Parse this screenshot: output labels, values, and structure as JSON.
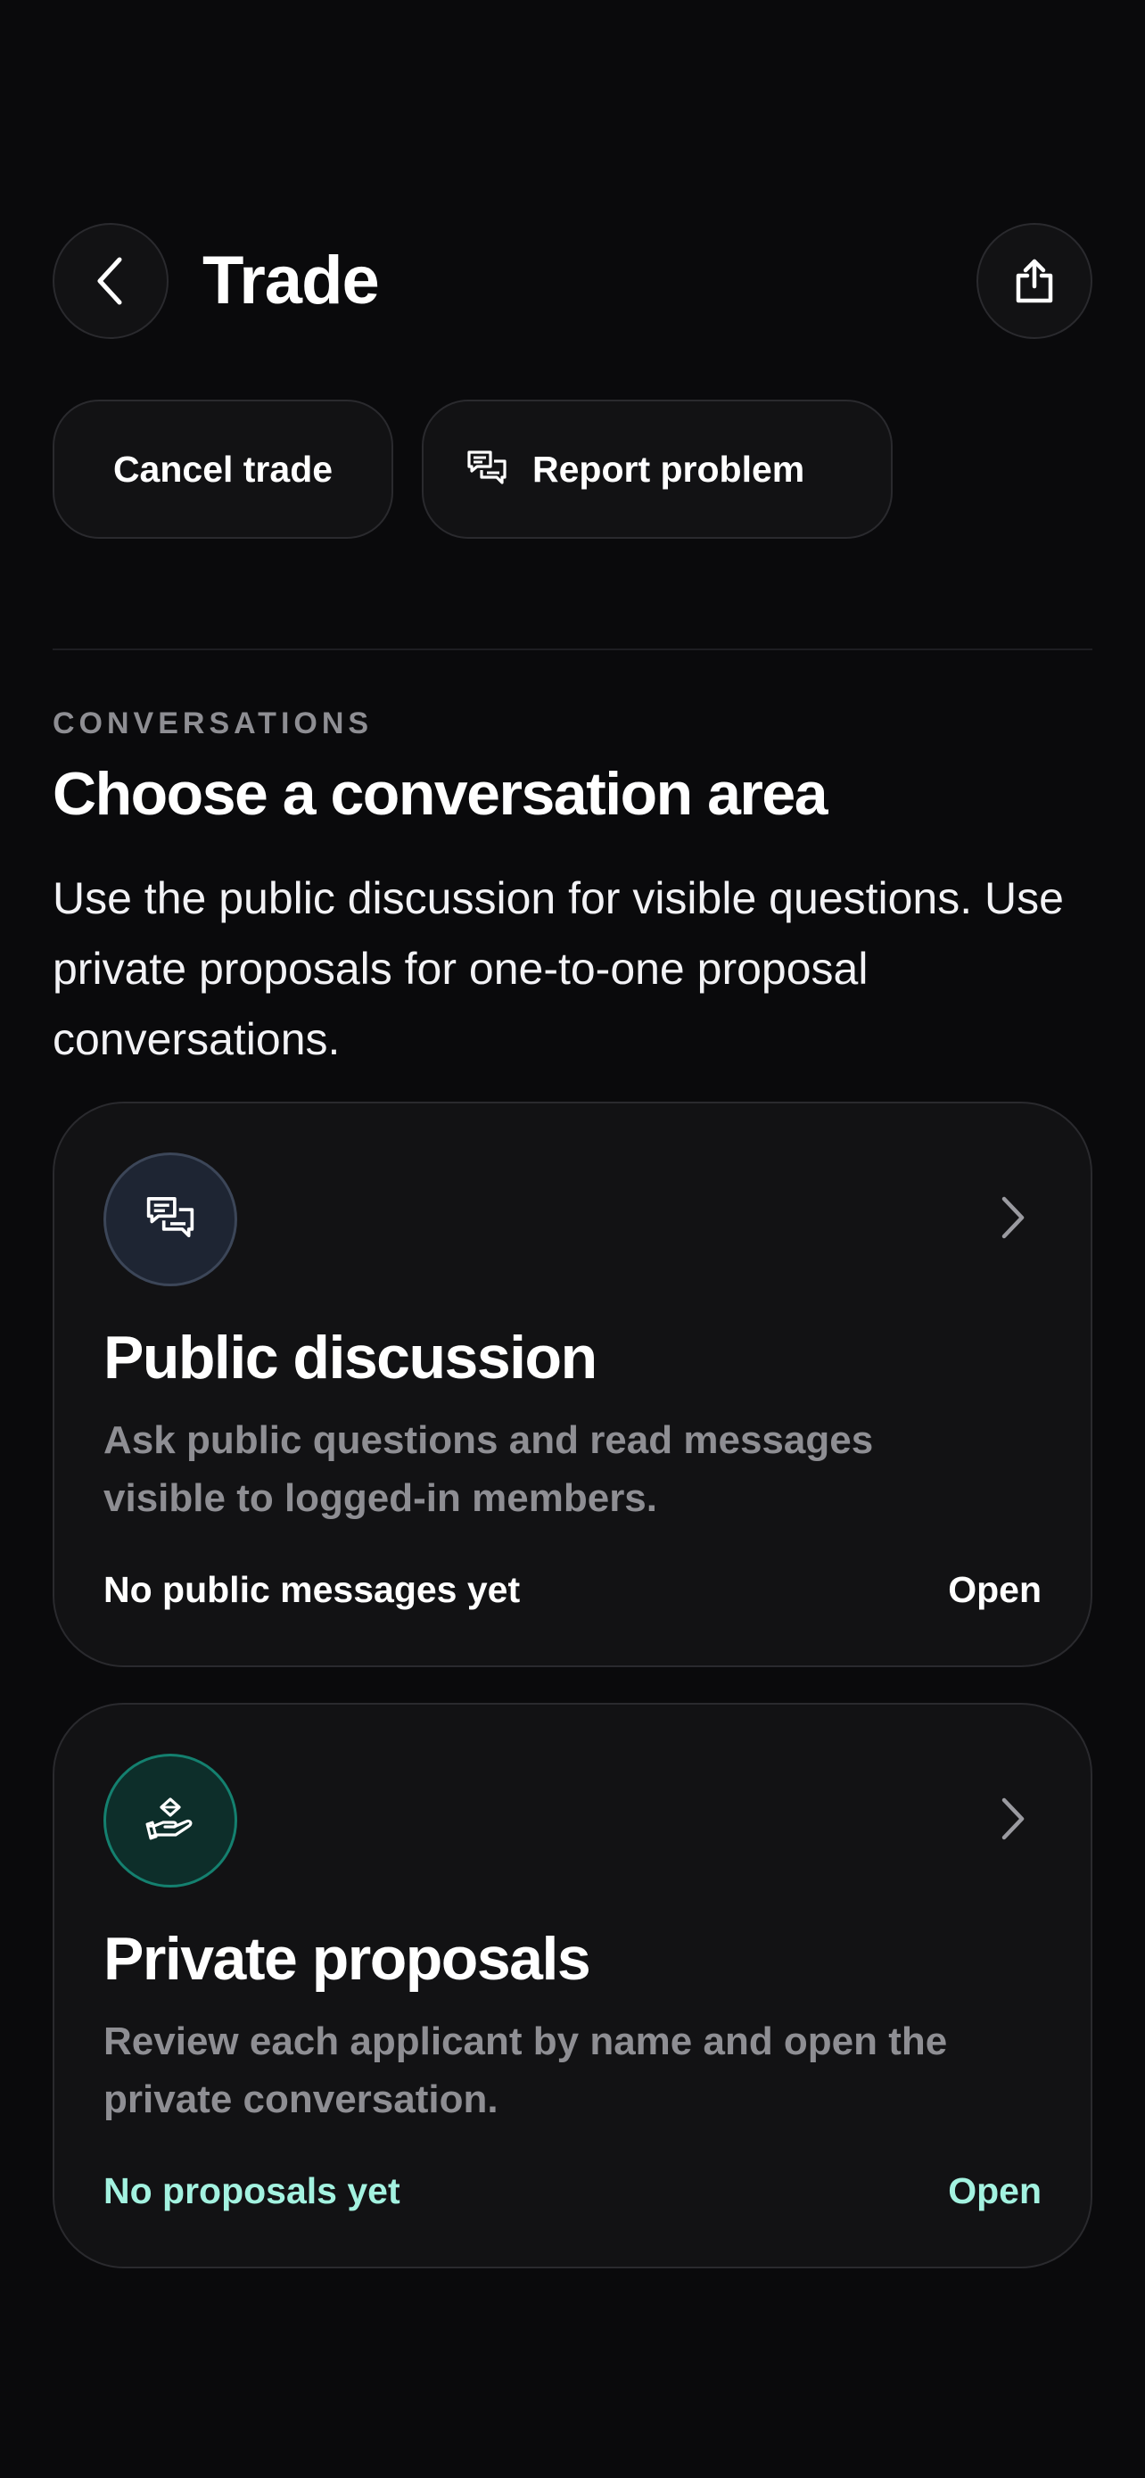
{
  "header": {
    "title": "Trade",
    "back_icon": "chevron-left-icon",
    "share_icon": "share-icon"
  },
  "actions": {
    "cancel_label": "Cancel trade",
    "report_label": "Report problem",
    "report_icon": "chat-bubbles-icon"
  },
  "section": {
    "eyebrow": "CONVERSATIONS",
    "title": "Choose a conversation area",
    "description": "Use the public discussion for visible questions. Use private proposals for one-to-one proposal conversations."
  },
  "cards": [
    {
      "icon": "chat-bubbles-icon",
      "title": "Public discussion",
      "description": "Ask public questions and read messages visible to logged-in members.",
      "status": "No public messages yet",
      "action": "Open"
    },
    {
      "icon": "hand-offer-icon",
      "title": "Private proposals",
      "description": "Review each applicant by name and open the private conversation.",
      "status": "No proposals yet",
      "action": "Open"
    }
  ],
  "colors": {
    "background": "#0a0a0c",
    "surface": "#121214",
    "border": "#2a2a2e",
    "muted_text": "#8e8e93",
    "accent_teal": "#a3f2e0"
  }
}
